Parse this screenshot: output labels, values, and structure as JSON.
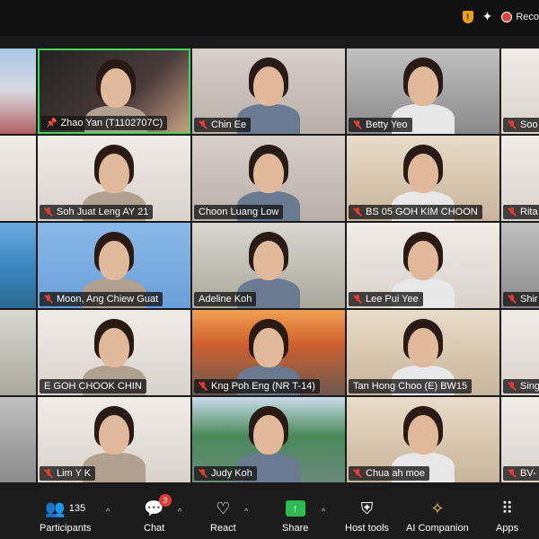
{
  "header": {
    "record_label": "Reco"
  },
  "participants": [
    {
      "name": "",
      "bg": "bg-city",
      "muted": false
    },
    {
      "name": "Zhao Yan (T1102707C)",
      "bg": "bg-dark",
      "muted": false,
      "pinned": true,
      "active": true
    },
    {
      "name": "Chin Ee",
      "bg": "bg-room1",
      "muted": true
    },
    {
      "name": "Betty Yeo",
      "bg": "bg-grey",
      "muted": true
    },
    {
      "name": "Soo",
      "bg": "bg-white",
      "muted": true
    },
    {
      "name": "",
      "bg": "bg-white",
      "muted": false
    },
    {
      "name": "Soh Juat Leng AY 21",
      "bg": "bg-white",
      "muted": true
    },
    {
      "name": "Choon Luang Low",
      "bg": "bg-room1",
      "muted": false
    },
    {
      "name": "BS 05 GOH KIM CHOON",
      "bg": "bg-warm",
      "muted": true
    },
    {
      "name": "Rita",
      "bg": "bg-white",
      "muted": true
    },
    {
      "name": "",
      "bg": "bg-sea",
      "muted": false
    },
    {
      "name": "Moon, Ang Chiew Guat",
      "bg": "bg-blue",
      "muted": true
    },
    {
      "name": "Adeline Koh",
      "bg": "bg-room2",
      "muted": false
    },
    {
      "name": "Lee Pui Yee",
      "bg": "bg-white",
      "muted": true
    },
    {
      "name": "Shir",
      "bg": "bg-grey",
      "muted": true
    },
    {
      "name": "",
      "bg": "bg-room2",
      "muted": false
    },
    {
      "name": "E GOH CHOOK CHIN",
      "bg": "bg-white",
      "muted": false
    },
    {
      "name": "Kng Poh Eng (NR T-14)",
      "bg": "bg-sunset",
      "muted": true
    },
    {
      "name": "Tan Hong Choo (E) BW15",
      "bg": "bg-warm",
      "muted": false
    },
    {
      "name": "Sing",
      "bg": "bg-white",
      "muted": true
    },
    {
      "name": "",
      "bg": "bg-grey",
      "muted": false
    },
    {
      "name": "Lim Y K",
      "bg": "bg-white",
      "muted": true
    },
    {
      "name": "Judy Koh",
      "bg": "bg-lake",
      "muted": true
    },
    {
      "name": "Chua ah moe",
      "bg": "bg-warm",
      "muted": true
    },
    {
      "name": "BV-",
      "bg": "bg-white",
      "muted": true
    }
  ],
  "toolbar": {
    "participants_label": "Participants",
    "participants_count": "135",
    "chat_label": "Chat",
    "chat_badge": "3",
    "react_label": "React",
    "share_label": "Share",
    "host_tools_label": "Host tools",
    "ai_label": "AI Companion",
    "apps_label": "Apps"
  }
}
